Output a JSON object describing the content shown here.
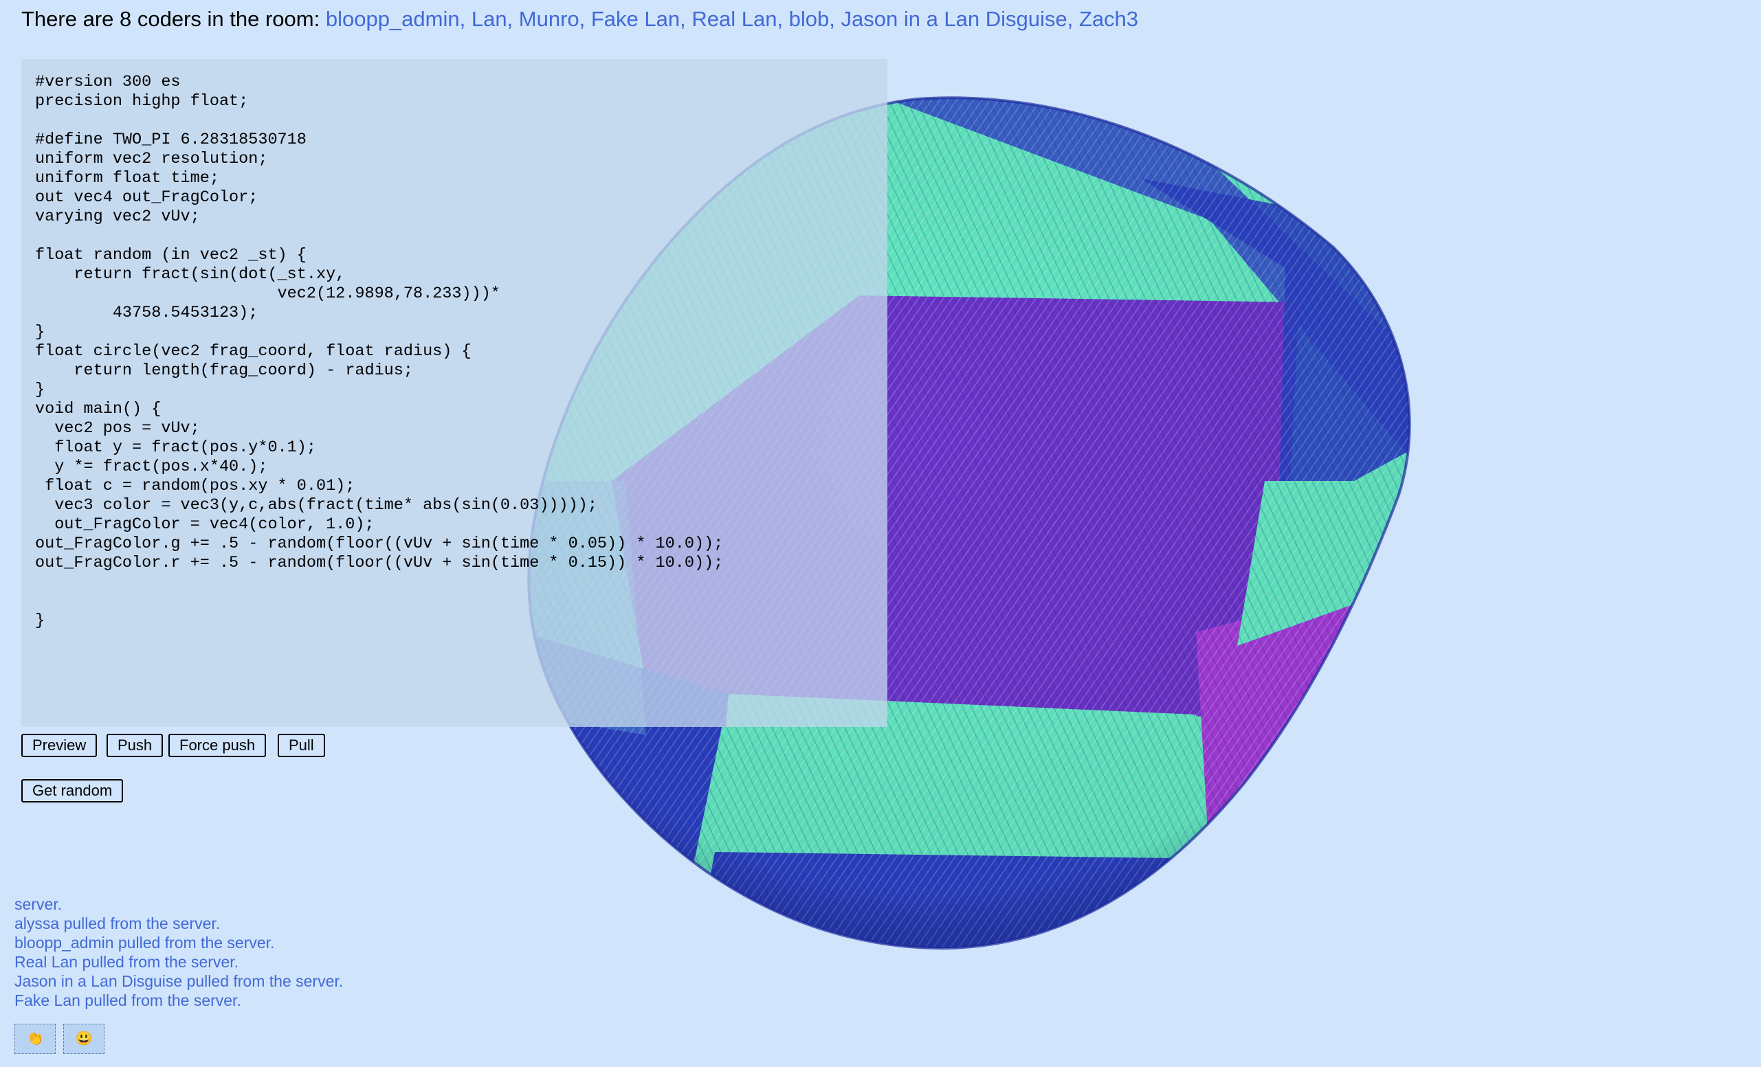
{
  "header": {
    "prefix": "There are 8 coders in the room:",
    "names": "bloopp_admin, Lan, Munro, Fake Lan, Real Lan, blob, Jason in a Lan Disguise, Zach3"
  },
  "editor": {
    "code": "#version 300 es\nprecision highp float;\n\n#define TWO_PI 6.28318530718\nuniform vec2 resolution;\nuniform float time;\nout vec4 out_FragColor;\nvarying vec2 vUv;\n\nfloat random (in vec2 _st) {\n    return fract(sin(dot(_st.xy,\n                         vec2(12.9898,78.233)))*\n        43758.5453123);\n}\nfloat circle(vec2 frag_coord, float radius) {\n    return length(frag_coord) - radius;\n}\nvoid main() {\n  vec2 pos = vUv;\n  float y = fract(pos.y*0.1);\n  y *= fract(pos.x*40.);\n float c = random(pos.xy * 0.01);\n  vec3 color = vec3(y,c,abs(fract(time* abs(sin(0.03)))));\n  out_FragColor = vec4(color, 1.0);\nout_FragColor.g += .5 - random(floor((vUv + sin(time * 0.05)) * 10.0));\nout_FragColor.r += .5 - random(floor((vUv + sin(time * 0.15)) * 10.0));\n\n\n}"
  },
  "buttons": {
    "preview": "Preview",
    "push": "Push",
    "force_push": "Force push",
    "pull": "Pull",
    "get_random": "Get random"
  },
  "log": [
    "server.",
    "alyssa pulled from the server.",
    "bloopp_admin pulled from the server.",
    "Real Lan pulled from the server.",
    "Jason in a Lan Disguise pulled from the server.",
    "Fake Lan pulled from the server."
  ],
  "reactions": {
    "clap": "👏",
    "smile": "😃"
  },
  "colors": {
    "background": "#d0e4fb",
    "link": "#4169d6",
    "shape_teal": "#5fe6bf",
    "shape_blue": "#2a3fc2",
    "shape_purple": "#6a32c8",
    "shape_magenta": "#a23ad6"
  }
}
